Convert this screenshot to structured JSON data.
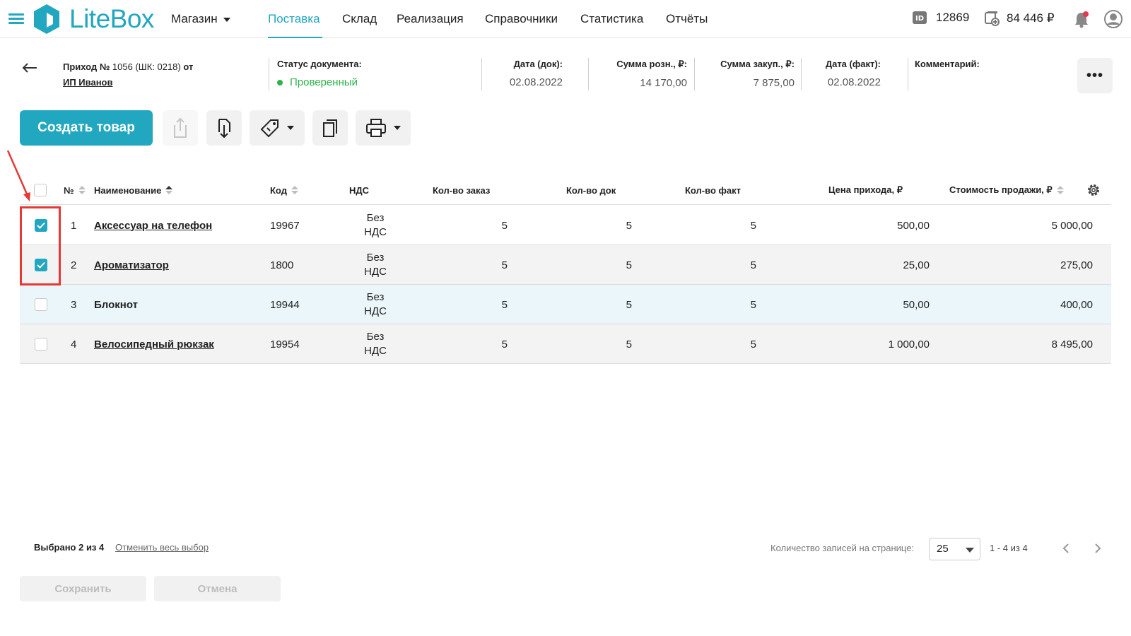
{
  "header": {
    "logo_text": "LiteBox",
    "store": "Магазин",
    "nav": [
      {
        "label": "Поставка",
        "active": true
      },
      {
        "label": "Склад"
      },
      {
        "label": "Реализация"
      },
      {
        "label": "Справочники"
      },
      {
        "label": "Статистика"
      },
      {
        "label": "Отчёты"
      }
    ],
    "account_id": "12869",
    "balance": "84 446 ₽",
    "accent_color": "#22a7c0"
  },
  "document": {
    "title_prefix": "Приход №",
    "title_num": " 1056 (ШК: 0218) ",
    "title_suffix": "от",
    "supplier": "ИП Иванов",
    "status_label": "Статус документа:",
    "status_value": "Проверенный",
    "doc_date_label": "Дата (док):",
    "doc_date": "02.08.2022",
    "retail_sum_label": "Сумма розн., ₽:",
    "retail_sum": "14 170,00",
    "purchase_sum_label": "Сумма закуп., ₽:",
    "purchase_sum": "7 875,00",
    "fact_date_label": "Дата (факт):",
    "fact_date": "02.08.2022",
    "comment_label": "Комментарий:",
    "more_label": "•••"
  },
  "toolbar": {
    "create_label": "Создать товар"
  },
  "table": {
    "headers": {
      "num": "№",
      "name": "Наименование",
      "code": "Код",
      "vat": "НДС",
      "qty_order": "Кол-во заказ",
      "qty_doc": "Кол-во док",
      "qty_fact": "Кол-во факт",
      "price_in": "Цена прихода, ₽",
      "sale_cost": "Стоимость продажи, ₽"
    },
    "rows": [
      {
        "checked": true,
        "num": "1",
        "name": "Аксессуар на телефон",
        "code": "19967",
        "vat": "Без НДС",
        "qty_order": "5",
        "qty_doc": "5",
        "qty_fact": "5",
        "price_in": "500,00",
        "sale_cost": "5 000,00"
      },
      {
        "checked": true,
        "num": "2",
        "name": "Ароматизатор",
        "code": "1800",
        "vat": "Без НДС",
        "qty_order": "5",
        "qty_doc": "5",
        "qty_fact": "5",
        "price_in": "25,00",
        "sale_cost": "275,00"
      },
      {
        "checked": false,
        "num": "3",
        "name": "Блокнот",
        "code": "19944",
        "vat": "Без НДС",
        "qty_order": "5",
        "qty_doc": "5",
        "qty_fact": "5",
        "price_in": "50,00",
        "sale_cost": "400,00"
      },
      {
        "checked": false,
        "num": "4",
        "name": "Велосипедный рюкзак",
        "code": "19954",
        "vat": "Без НДС",
        "qty_order": "5",
        "qty_doc": "5",
        "qty_fact": "5",
        "price_in": "1 000,00",
        "sale_cost": "8 495,00"
      }
    ]
  },
  "footer": {
    "selected_text": "Выбрано 2 из 4",
    "clear_selection": "Отменить весь выбор",
    "per_page_label": "Количество записей на странице:",
    "per_page_value": "25",
    "range": "1 - 4 из 4",
    "save_label": "Сохранить",
    "cancel_label": "Отмена"
  }
}
